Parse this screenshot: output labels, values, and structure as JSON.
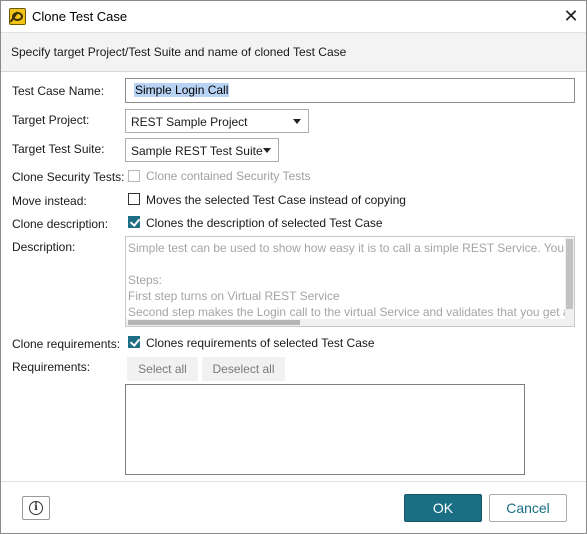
{
  "window": {
    "title": "Clone Test Case",
    "app_icon": "soapui-bug-icon",
    "close_icon": "close-icon"
  },
  "header": {
    "text": "Specify target Project/Test Suite and name of cloned Test Case"
  },
  "form": {
    "name_label": "Test Case Name:",
    "name_value": "Simple Login Call",
    "project_label": "Target Project:",
    "project_value": "REST Sample Project",
    "suite_label": "Target Test Suite:",
    "suite_value": "Sample REST Test Suite",
    "security_label": "Clone Security Tests:",
    "security_text": "Clone contained Security Tests",
    "security_checked": false,
    "security_enabled": false,
    "move_label": "Move instead:",
    "move_text": "Moves the selected Test Case instead of copying",
    "move_checked": false,
    "clone_desc_label": "Clone description:",
    "clone_desc_text": "Clones the description of selected Test Case",
    "clone_desc_checked": true,
    "description_label": "Description:",
    "description_text": "Simple test can be used to show how easy it is to call a simple REST Service. You can\n\nSteps:\nFirst step turns on Virtual REST Service\nSecond step makes the Login call to the virtual Service and validates that you get a \"",
    "clone_req_label": "Clone requirements:",
    "clone_req_text": "Clones requirements of selected Test Case",
    "clone_req_checked": true,
    "requirements_label": "Requirements:",
    "select_all": "Select all",
    "deselect_all": "Deselect all"
  },
  "footer": {
    "help_icon": "info-icon",
    "ok": "OK",
    "cancel": "Cancel"
  },
  "colors": {
    "accent": "#1a6f84",
    "selection": "#b8d3f4",
    "header_band": "#f3f3f3"
  }
}
